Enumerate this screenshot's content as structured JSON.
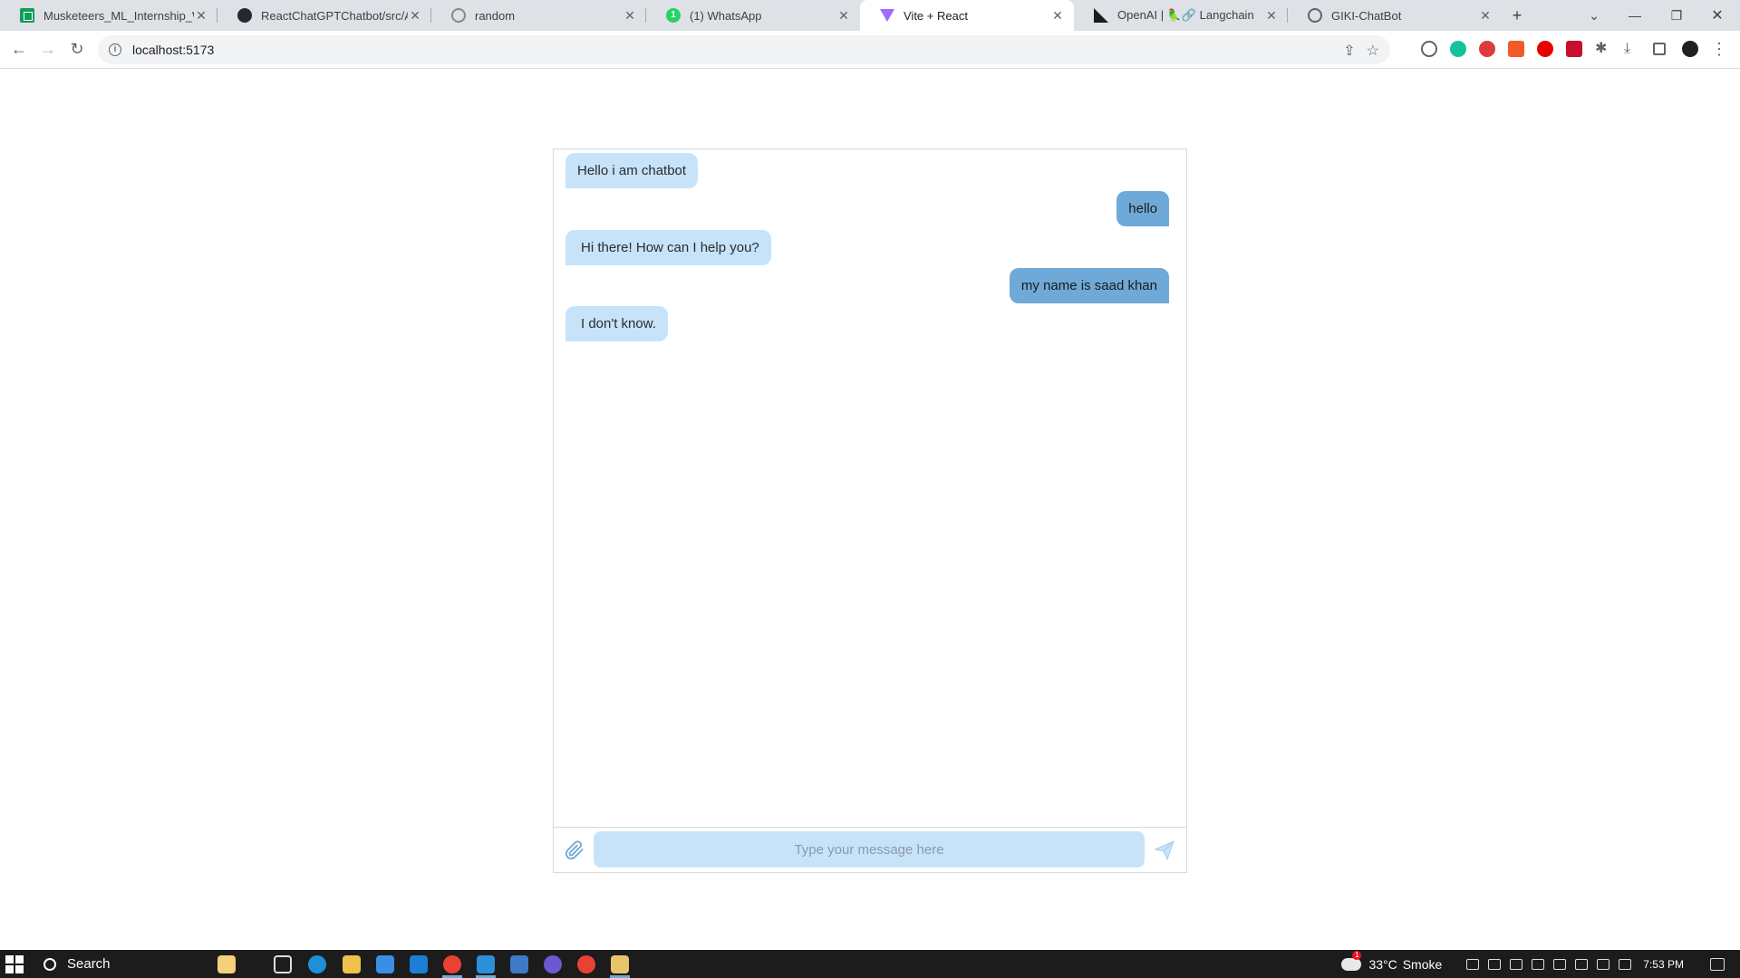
{
  "browser": {
    "tabs": [
      {
        "label": "Musketeers_ML_Internship_Wee",
        "icon": "sheets-icon"
      },
      {
        "label": "ReactChatGPTChatbot/src/App.j",
        "icon": "github-icon"
      },
      {
        "label": "random",
        "icon": "openai-icon"
      },
      {
        "label": "(1) WhatsApp",
        "icon": "whatsapp-icon"
      },
      {
        "label": "Vite + React",
        "icon": "vite-icon"
      },
      {
        "label": "OpenAI | 🦜🔗 Langchain",
        "icon": "openai-icon"
      },
      {
        "label": "GIKI-ChatBot",
        "icon": "globe-icon"
      }
    ],
    "address": {
      "url": "localhost:5173"
    }
  },
  "chat": {
    "messages": [
      {
        "sender": "bot",
        "text": "Hello i am chatbot"
      },
      {
        "sender": "user",
        "text": "hello"
      },
      {
        "sender": "bot",
        "text": "Hi there! How can I help you?"
      },
      {
        "sender": "user",
        "text": "my name is saad khan"
      },
      {
        "sender": "bot",
        "text": "I don't know."
      }
    ],
    "input": {
      "placeholder": "Type your message here",
      "value": ""
    }
  },
  "taskbar": {
    "search_label": "Search",
    "weather": {
      "temp": "33°C",
      "condition": "Smoke",
      "badge": "1"
    },
    "clock": "7:53 PM"
  },
  "colors": {
    "bot_bubble": "#c6e3fa",
    "user_bubble": "#6ea9d7",
    "input_bg": "#c6e3fa"
  }
}
